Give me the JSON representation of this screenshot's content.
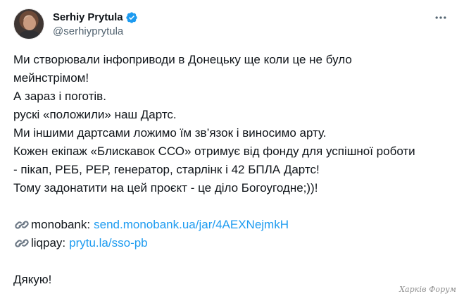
{
  "post": {
    "display_name": "Serhiy Prytula",
    "handle": "@serhiyprytula",
    "verified_icon": "verified-badge-icon",
    "more_icon": "more-horizontal-icon",
    "lines": [
      "Ми створювали інфоприводи в Донецьку ще коли це не було",
      "мейнстрімом!",
      "А зараз і поготів.",
      "рускі «положили» наш Дартс.",
      "Ми іншими дартсами ложимо їм зв’язок і виносимо арту.",
      "Кожен екіпаж «Блискавок ССО» отримує від фонду для успішної роботи",
      "- пікап, РЕБ, РЕР, генератор, старлінк і 42 БПЛА Дартс!",
      "Тому задонатити на цей проєкт - це діло Богоугодне;))!"
    ],
    "links": [
      {
        "icon": "link-icon",
        "label": "monobank:",
        "url_text": "send.monobank.ua/jar/4AEXNejmkH"
      },
      {
        "icon": "link-icon",
        "label": "liqpay:",
        "url_text": "prytu.la/sso-pb"
      }
    ],
    "thanks": "Дякую!"
  },
  "watermark": "Харків Форум",
  "colors": {
    "text": "#0f1419",
    "secondary": "#536471",
    "link": "#1d9bf0",
    "verified": "#1d9bf0"
  }
}
